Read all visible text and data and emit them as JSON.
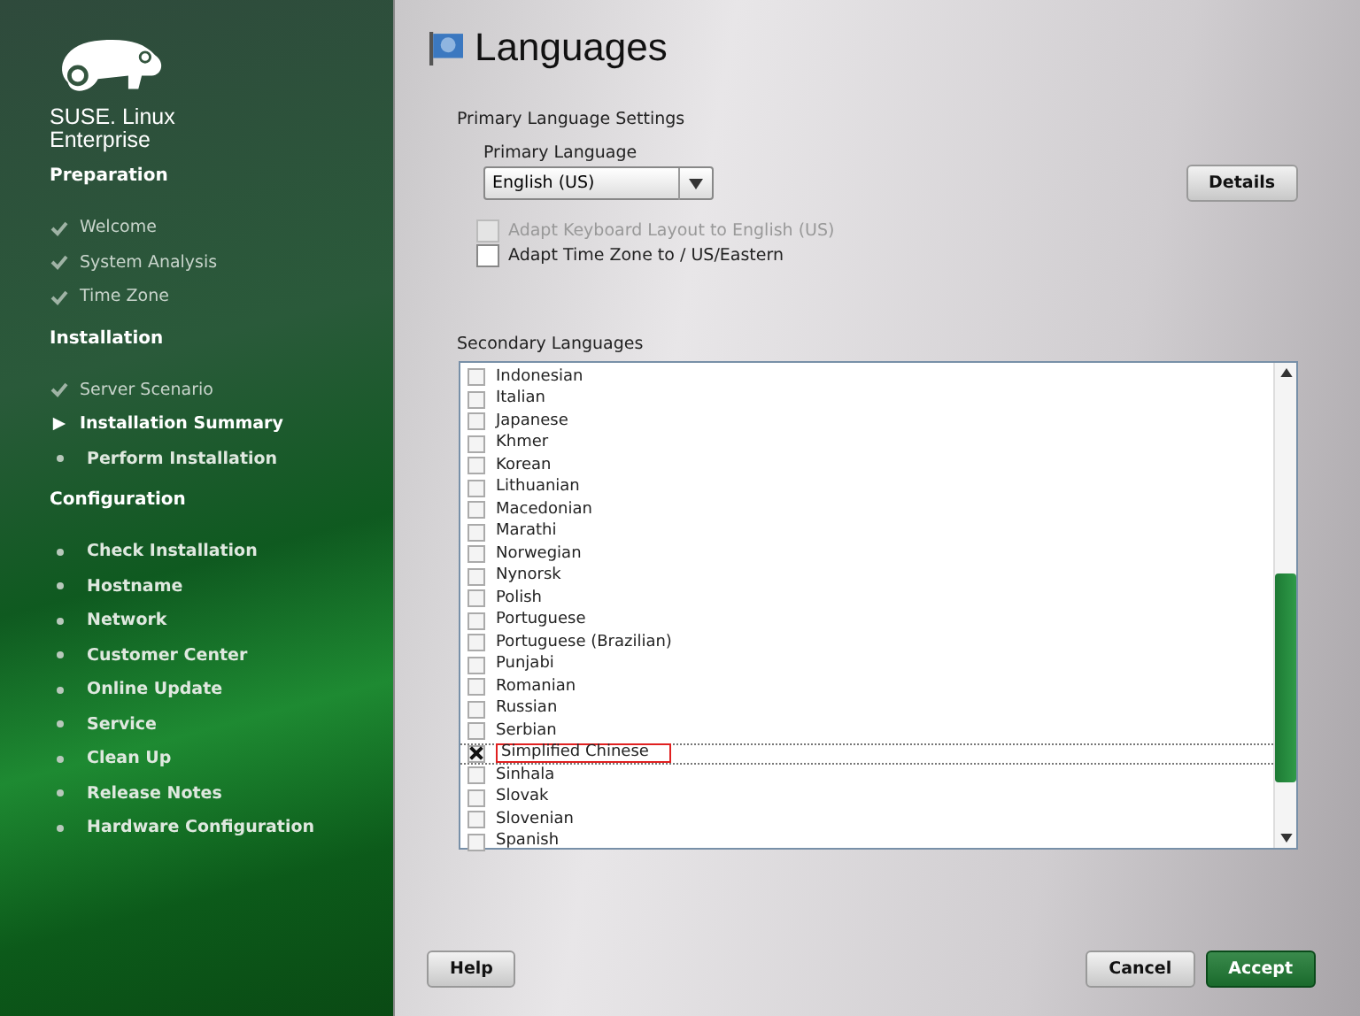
{
  "sidebar": {
    "product": "SUSE. Linux Enterprise",
    "sections": [
      {
        "title": "Preparation",
        "items": [
          {
            "label": "Welcome",
            "kind": "done"
          },
          {
            "label": "System Analysis",
            "kind": "done"
          },
          {
            "label": "Time Zone",
            "kind": "done"
          }
        ]
      },
      {
        "title": "Installation",
        "items": [
          {
            "label": "Server Scenario",
            "kind": "done"
          },
          {
            "label": "Installation Summary",
            "kind": "current"
          },
          {
            "label": "Perform Installation",
            "kind": "pending"
          }
        ]
      },
      {
        "title": "Configuration",
        "items": [
          {
            "label": "Check Installation",
            "kind": "pending"
          },
          {
            "label": "Hostname",
            "kind": "pending"
          },
          {
            "label": "Network",
            "kind": "pending"
          },
          {
            "label": "Customer Center",
            "kind": "pending"
          },
          {
            "label": "Online Update",
            "kind": "pending"
          },
          {
            "label": "Service",
            "kind": "pending"
          },
          {
            "label": "Clean Up",
            "kind": "pending"
          },
          {
            "label": "Release Notes",
            "kind": "pending"
          },
          {
            "label": "Hardware Configuration",
            "kind": "pending"
          }
        ]
      }
    ]
  },
  "page": {
    "title": "Languages",
    "primary": {
      "group_label": "Primary Language Settings",
      "field_label": "Primary Language",
      "value": "English (US)",
      "options": [
        {
          "label": "Adapt Keyboard Layout to English (US)",
          "checked": false,
          "disabled": true
        },
        {
          "label": "Adapt Time Zone to  / US/Eastern",
          "checked": false,
          "disabled": false
        }
      ],
      "details_button": "Details"
    },
    "secondary": {
      "label": "Secondary Languages",
      "languages": [
        {
          "name": "Indonesian",
          "checked": false,
          "annotated": false
        },
        {
          "name": "Italian",
          "checked": false,
          "annotated": false
        },
        {
          "name": "Japanese",
          "checked": false,
          "annotated": false
        },
        {
          "name": "Khmer",
          "checked": false,
          "annotated": false
        },
        {
          "name": "Korean",
          "checked": false,
          "annotated": false
        },
        {
          "name": "Lithuanian",
          "checked": false,
          "annotated": false
        },
        {
          "name": "Macedonian",
          "checked": false,
          "annotated": false
        },
        {
          "name": "Marathi",
          "checked": false,
          "annotated": false
        },
        {
          "name": "Norwegian",
          "checked": false,
          "annotated": false
        },
        {
          "name": "Nynorsk",
          "checked": false,
          "annotated": false
        },
        {
          "name": "Polish",
          "checked": false,
          "annotated": false
        },
        {
          "name": "Portuguese",
          "checked": false,
          "annotated": false
        },
        {
          "name": "Portuguese (Brazilian)",
          "checked": false,
          "annotated": false
        },
        {
          "name": "Punjabi",
          "checked": false,
          "annotated": false
        },
        {
          "name": "Romanian",
          "checked": false,
          "annotated": false
        },
        {
          "name": "Russian",
          "checked": false,
          "annotated": false
        },
        {
          "name": "Serbian",
          "checked": false,
          "annotated": false
        },
        {
          "name": "Simplified Chinese",
          "checked": true,
          "annotated": true
        },
        {
          "name": "Sinhala",
          "checked": false,
          "annotated": false
        },
        {
          "name": "Slovak",
          "checked": false,
          "annotated": false
        },
        {
          "name": "Slovenian",
          "checked": false,
          "annotated": false
        },
        {
          "name": "Spanish",
          "checked": false,
          "annotated": false
        }
      ]
    }
  },
  "buttons": {
    "help": "Help",
    "cancel": "Cancel",
    "accept": "Accept"
  }
}
